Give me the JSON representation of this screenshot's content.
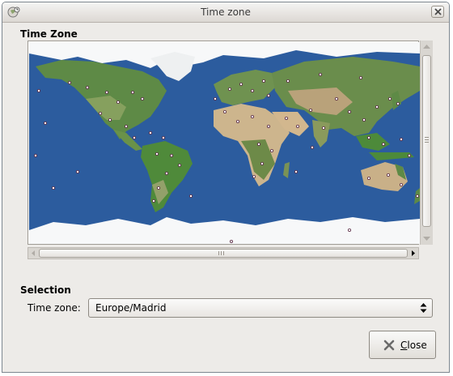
{
  "window": {
    "title": "Time zone"
  },
  "map_section": {
    "title": "Time Zone"
  },
  "selection_section": {
    "title": "Selection",
    "timezone_label": "Time zone:",
    "timezone_value": "Europe/Madrid"
  },
  "buttons": {
    "close_mnemonic": "C",
    "close_rest": "lose"
  },
  "icons": {
    "app": "timezone-app-icon",
    "window_close": "close-icon",
    "combo": "updown-arrows-icon",
    "button_close": "close-x-icon",
    "scroll_left": "arrow-left-icon",
    "scroll_right": "arrow-right-icon"
  },
  "colors": {
    "ocean": "#2c5c9e",
    "land": "#5f8a45",
    "desert": "#c8b08a",
    "ice": "#ffffff"
  }
}
